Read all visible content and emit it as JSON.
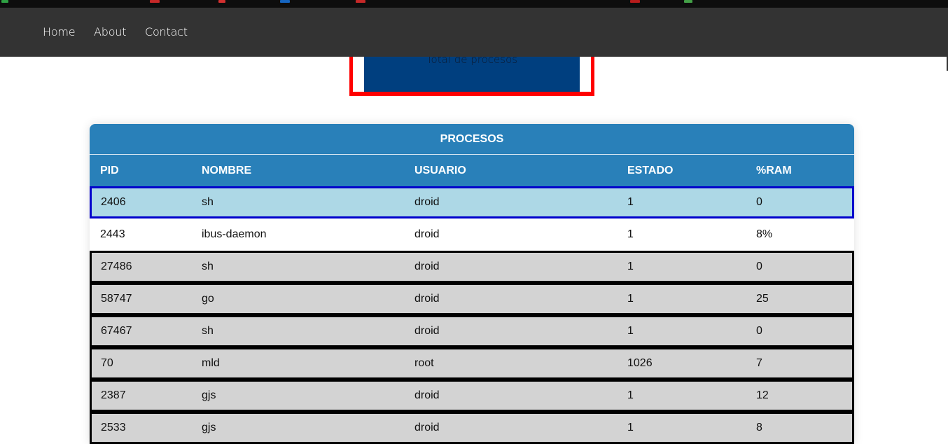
{
  "nav": {
    "links": [
      "Home",
      "About",
      "Contact"
    ]
  },
  "summary_card": {
    "label": "Total de procesos"
  },
  "colors": {
    "navbar": "#333333",
    "table_header": "#2980b9",
    "selected_row": "#add8e6",
    "selected_border": "#0000cc",
    "card_border": "#ff0000",
    "card_fill": "#003f7f"
  },
  "table": {
    "title": "PROCESOS",
    "columns": [
      "PID",
      "NOMBRE",
      "USUARIO",
      "ESTADO",
      "%RAM"
    ],
    "rows": [
      {
        "pid": "2406",
        "nombre": "sh",
        "usuario": "droid",
        "estado": "1",
        "ram": "0",
        "state": "selected"
      },
      {
        "pid": "2443",
        "nombre": "ibus-daemon",
        "usuario": "droid",
        "estado": "1",
        "ram": "8%",
        "state": "plain"
      },
      {
        "pid": "27486",
        "nombre": "sh",
        "usuario": "droid",
        "estado": "1",
        "ram": "0",
        "state": "gray"
      },
      {
        "pid": "58747",
        "nombre": "go",
        "usuario": "droid",
        "estado": "1",
        "ram": "25",
        "state": "gray"
      },
      {
        "pid": "67467",
        "nombre": "sh",
        "usuario": "droid",
        "estado": "1",
        "ram": "0",
        "state": "gray"
      },
      {
        "pid": "70",
        "nombre": "mld",
        "usuario": "root",
        "estado": "1026",
        "ram": "7",
        "state": "gray"
      },
      {
        "pid": "2387",
        "nombre": "gjs",
        "usuario": "droid",
        "estado": "1",
        "ram": "12",
        "state": "gray"
      },
      {
        "pid": "2533",
        "nombre": "gjs",
        "usuario": "droid",
        "estado": "1",
        "ram": "8",
        "state": "gray"
      }
    ]
  }
}
